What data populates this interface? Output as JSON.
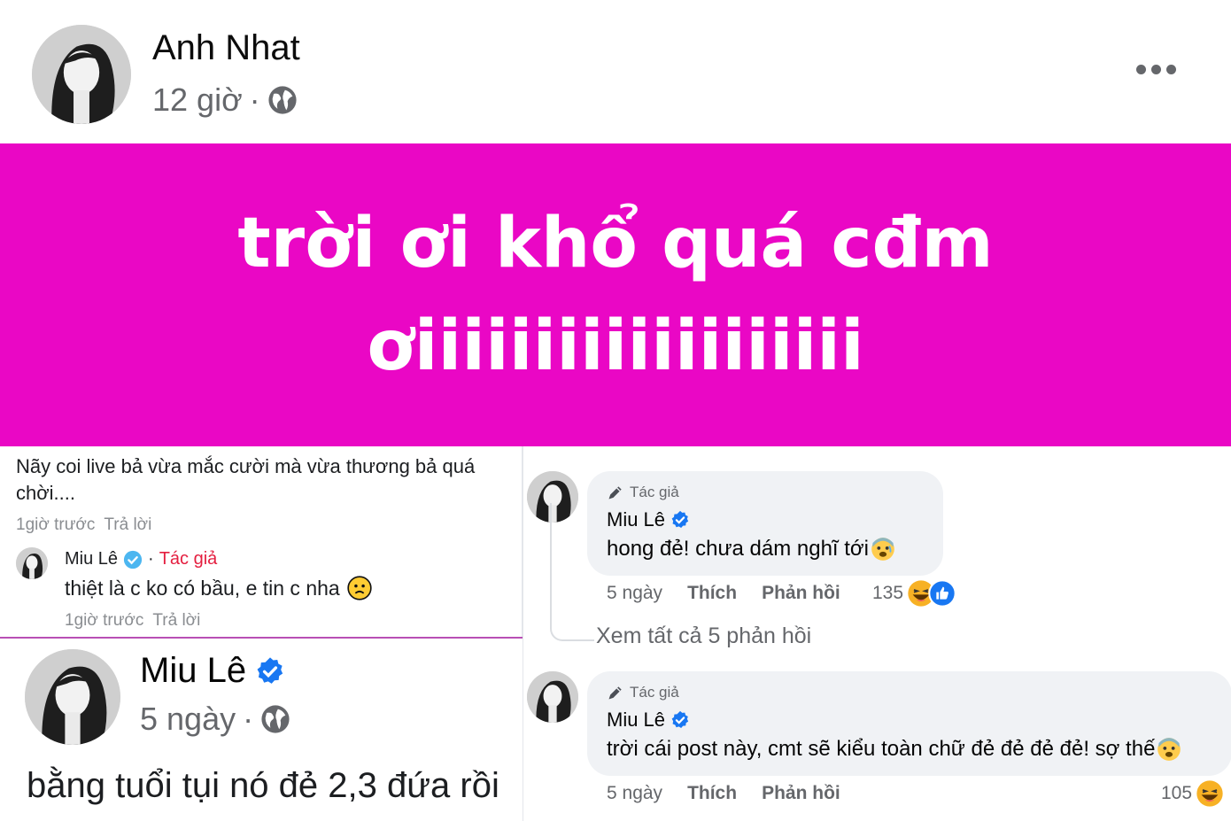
{
  "post": {
    "author": "Anh Nhat",
    "time": "12 giờ",
    "separator": "·",
    "privacy_icon": "globe-icon",
    "more_icon": "more-options-icon",
    "banner_text": "trời ơi khổ quá cđm ơiiiiiiiiiiiiiiiiiii",
    "banner_color": "#ea07c5"
  },
  "left_comment": {
    "text": "Nãy coi live bả vừa mắc cười mà vừa thương bả quá chời....",
    "time": "1giờ trước",
    "reply_label": "Trả lời",
    "reply": {
      "author": "Miu Lê",
      "tag_separator": "·",
      "tag": "Tác giả",
      "text": "thiệt là c ko có bầu, e tin c nha",
      "emoji": "worried-face-emoji",
      "time": "1giờ trước",
      "reply_label": "Trả lời"
    }
  },
  "bottom_post": {
    "author": "Miu Lê",
    "time": "5 ngày",
    "separator": "·",
    "text": "bằng tuổi tụi nó đẻ 2,3 đứa rồi"
  },
  "right_comments": [
    {
      "tag": "Tác giả",
      "author": "Miu Lê",
      "text": "hong đẻ! chưa dám nghĩ tới",
      "emoji": "anxious-face-emoji",
      "time": "5 ngày",
      "like_label": "Thích",
      "reply_label": "Phản hồi",
      "reaction_count": "135"
    },
    {
      "tag": "Tác giả",
      "author": "Miu Lê",
      "text": "trời cái post này, cmt sẽ kiểu toàn chữ đẻ đẻ đẻ đẻ! sợ thế",
      "emoji": "anxious-face-emoji",
      "time": "5 ngày",
      "like_label": "Thích",
      "reply_label": "Phản hồi",
      "reaction_count": "105"
    }
  ],
  "see_all_replies": "Xem tất cả 5 phản hồi",
  "colors": {
    "verified": "#1877f2",
    "author_tag_red": "#e41e3f",
    "meta_gray": "#65676b"
  }
}
